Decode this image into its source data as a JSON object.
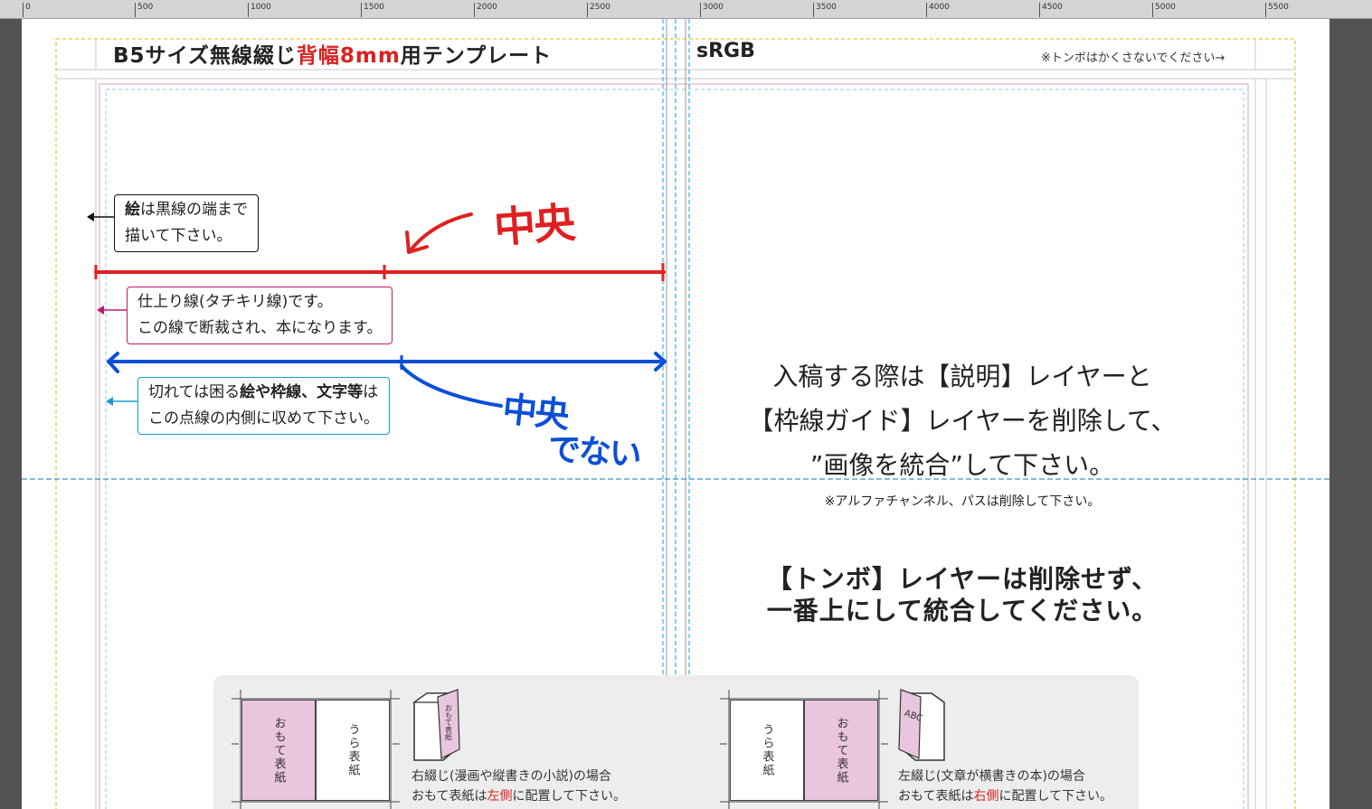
{
  "ruler": {
    "labels": [
      "0",
      "500",
      "1000",
      "1500",
      "2000",
      "2500",
      "3000",
      "3500",
      "4000",
      "4500",
      "5000",
      "5500"
    ]
  },
  "header": {
    "title_prefix": "B5サイズ無線綴じ",
    "title_red": "背幅8mm",
    "title_suffix": "用テンプレート",
    "color_mode": "sRGB",
    "tonbo_note": "※トンボはかくさないでください→"
  },
  "callouts": {
    "draw": {
      "line1_bold": "絵",
      "line1_rest": "は黒線の端まで",
      "line2": "描いて下さい。"
    },
    "trim": {
      "line1": "仕上り線(タチキリ線)です。",
      "line2": "この線で断裁され、本になります。"
    },
    "safe": {
      "line1_a": "切れては困る",
      "line1_bold": "絵や枠線、文字等",
      "line1_b": "は",
      "line2": "この点線の内側に収めて下さい。"
    }
  },
  "handwriting": {
    "red_label": "中央",
    "blue_label1": "中央",
    "blue_label2": "でない"
  },
  "instructions": {
    "line1": "入稿する際は【説明】レイヤーと",
    "line2": "【枠線ガイド】レイヤーを削除して、",
    "line3": "”画像を統合”して下さい。",
    "note": "※アルファチャンネル、パスは削除して下さい。",
    "tonbo1": "【トンボ】レイヤーは削除せず、",
    "tonbo2": "一番上にして統合してください。"
  },
  "diagram": {
    "right_bind": {
      "front": "おもて表紙",
      "back": "うら表紙",
      "book_text": "おもて表紙",
      "caption1": "右綴じ(漫画や縦書きの小説)の場合",
      "caption2_a": "おもて表紙は",
      "caption2_red": "左側",
      "caption2_b": "に配置して下さい。"
    },
    "left_bind": {
      "front": "おもて表紙",
      "back": "うら表紙",
      "book_text": "ABC",
      "caption1": "左綴じ(文章が横書きの本)の場合",
      "caption2_a": "おもて表紙は",
      "caption2_red": "右側",
      "caption2_b": "に配置して下さい。"
    }
  },
  "colors": {
    "trim_line": "#d0457f",
    "safe_line": "#1a9ad6",
    "annotation_red": "#e02020",
    "annotation_blue": "#0a4fd8",
    "guide_cyan": "#00b4e6",
    "bleed_yellow": "#e6b800",
    "cover_pink": "#e9c6de"
  }
}
